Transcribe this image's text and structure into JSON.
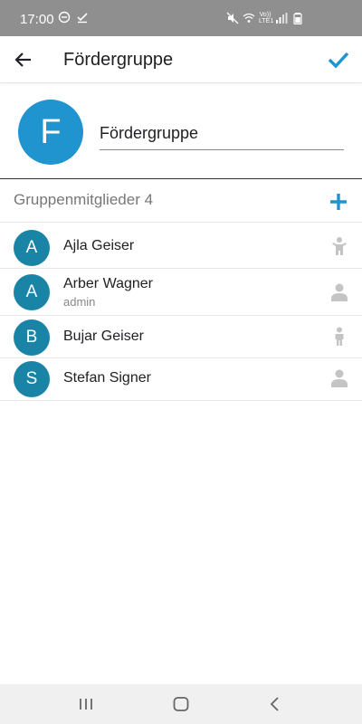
{
  "status_bar": {
    "time": "17:00",
    "net_label_top": "Vo))",
    "net_label_bottom": "LTE1"
  },
  "app_bar": {
    "title": "Fördergruppe",
    "back_icon": "arrow-left-icon",
    "confirm_icon": "check-icon",
    "accent_color": "#1f94cf"
  },
  "group": {
    "avatar_letter": "F",
    "name_value": "Fördergruppe",
    "avatar_color": "#1f94cf"
  },
  "members_section": {
    "title": "Gruppenmitglieder 4",
    "add_icon": "plus-icon"
  },
  "members": [
    {
      "initial": "A",
      "name": "Ajla Geiser",
      "role": "",
      "icon": "child-icon"
    },
    {
      "initial": "A",
      "name": "Arber Wagner",
      "role": "admin",
      "icon": "person-icon"
    },
    {
      "initial": "B",
      "name": "Bujar Geiser",
      "role": "",
      "icon": "child-icon"
    },
    {
      "initial": "S",
      "name": "Stefan Signer",
      "role": "",
      "icon": "person-icon"
    }
  ],
  "nav_bar": {
    "recents_icon": "recents-icon",
    "home_icon": "home-icon",
    "back_icon": "nav-back-icon"
  }
}
